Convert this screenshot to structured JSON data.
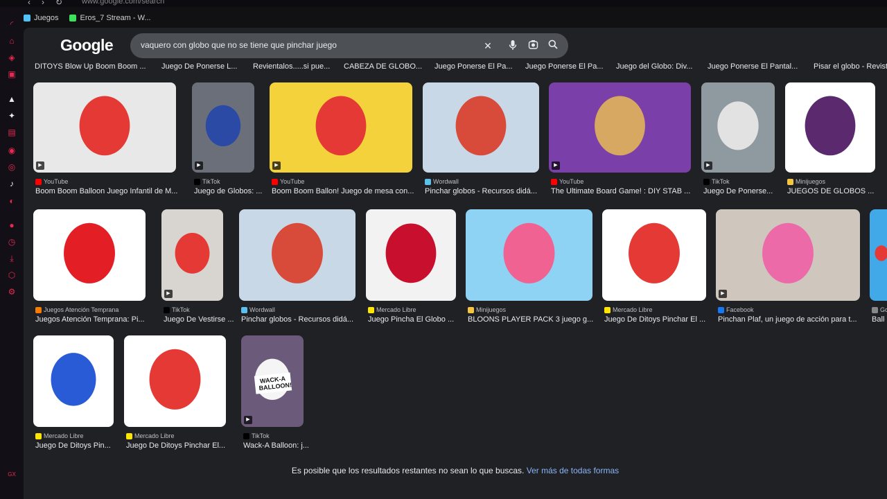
{
  "browser": {
    "url": "www.google.com/search",
    "bookmarks": [
      {
        "label": "Juegos",
        "color": "#4fc3f7"
      },
      {
        "label": "Eros_7 Stream - W...",
        "color": "#39e35a"
      }
    ]
  },
  "sidebar": {
    "icons": [
      "gx-corner-icon",
      "bag-icon",
      "shield-icon",
      "video-icon",
      "arrow-icon",
      "chatgpt-icon",
      "twitch-icon",
      "whatsapp-icon",
      "instagram-icon",
      "tiktok-icon",
      "discord-icon",
      "circle-icon",
      "clock-icon",
      "download-icon",
      "cube-icon",
      "settings-icon"
    ],
    "bottom_label": "GX"
  },
  "header": {
    "logo": "Google",
    "search_value": "vaquero con globo que no se tiene que pinchar juego"
  },
  "truncated_titles": [
    "DITOYS Blow Up Boom Boom ...",
    "Juego De Ponerse L...",
    "Revientalos.....si pue...",
    "CABEZA DE GLOBO...",
    "Juego Ponerse El Pa...",
    "Juego Ponerse El Pa...",
    "Juego del Globo: Div...",
    "Juego Ponerse El Pantal...",
    "Pisar el globo - Revista"
  ],
  "rows": [
    [
      {
        "source": "YouTube",
        "title": "Boom Boom Balloon Juego Infantil de M...",
        "video": true,
        "scol": "#ff0000",
        "bg": "#e8e8e8",
        "accent": "#e53935"
      },
      {
        "source": "TikTok",
        "title": "Juego de Globos: ...",
        "video": true,
        "scol": "#000000",
        "bg": "#6b6f7a",
        "accent": "#2a4aa6"
      },
      {
        "source": "YouTube",
        "title": "Boom Boom Ballon! Juego de mesa con...",
        "video": true,
        "scol": "#ff0000",
        "bg": "#f4d23c",
        "accent": "#e53935"
      },
      {
        "source": "Wordwall",
        "title": "Pinchar globos - Recursos didá...",
        "video": false,
        "scol": "#5bc0eb",
        "bg": "#c9d8e6",
        "accent": "#d84a3a"
      },
      {
        "source": "YouTube",
        "title": "The Ultimate Board Game! : DIY STAB ...",
        "video": true,
        "scol": "#ff0000",
        "bg": "#7a3fa8",
        "accent": "#d7a861"
      },
      {
        "source": "TikTok",
        "title": "Juego De Ponerse...",
        "video": true,
        "scol": "#000000",
        "bg": "#8f9aa0",
        "accent": "#e2e2e2"
      },
      {
        "source": "Minijuegos",
        "title": "JUEGOS DE GLOBOS ...",
        "video": false,
        "scol": "#f5c542",
        "bg": "#ffffff",
        "accent": "#5b2a6e"
      }
    ],
    [
      {
        "source": "Juegos Atención Temprana",
        "title": "Juegos Atención Temprana: Pi...",
        "video": false,
        "scol": "#f57c00",
        "bg": "#ffffff",
        "accent": "#e31e24"
      },
      {
        "source": "TikTok",
        "title": "Juego De Vestirse ...",
        "video": true,
        "scol": "#000000",
        "bg": "#d8d4d0",
        "accent": "#e53935"
      },
      {
        "source": "Wordwall",
        "title": "Pinchar globos - Recursos didá...",
        "video": false,
        "scol": "#5bc0eb",
        "bg": "#c9d8e6",
        "accent": "#d84a3a"
      },
      {
        "source": "Mercado Libre",
        "title": "Juego Pincha El Globo ...",
        "video": false,
        "scol": "#ffe600",
        "bg": "#f2f2f2",
        "accent": "#c8102e"
      },
      {
        "source": "Minijuegos",
        "title": "BLOONS PLAYER PACK 3 juego g...",
        "video": false,
        "scol": "#f5c542",
        "bg": "#8fd3f4",
        "accent": "#f06292"
      },
      {
        "source": "Mercado Libre",
        "title": "Juego De Ditoys Pinchar El ...",
        "video": false,
        "scol": "#ffe600",
        "bg": "#ffffff",
        "accent": "#e53935"
      },
      {
        "source": "Facebook",
        "title": "Pinchan Plaf, un juego de acción para t...",
        "video": true,
        "scol": "#1877f2",
        "bg": "#cfc6bd",
        "accent": "#ec6aa8"
      },
      {
        "source": "Go",
        "title": "Ballo",
        "video": false,
        "scol": "#888888",
        "bg": "#41a9e8",
        "accent": "#e53935"
      }
    ],
    [
      {
        "source": "Mercado Libre",
        "title": "Juego De Ditoys Pin...",
        "video": false,
        "scol": "#ffe600",
        "bg": "#ffffff",
        "accent": "#2a5bd7"
      },
      {
        "source": "Mercado Libre",
        "title": "Juego De Ditoys Pinchar El...",
        "video": false,
        "scol": "#ffe600",
        "bg": "#ffffff",
        "accent": "#e53935"
      },
      {
        "source": "TikTok",
        "title": "Wack-A Balloon: j...",
        "video": true,
        "scol": "#000000",
        "bg": "#6b5a7a",
        "accent": "#f5f5f5",
        "overlay": "WACK-A BALLOON!"
      }
    ]
  ],
  "footer": {
    "text": "Es posible que los resultados restantes no sean lo que buscas.",
    "link": "Ver más de todas formas"
  }
}
